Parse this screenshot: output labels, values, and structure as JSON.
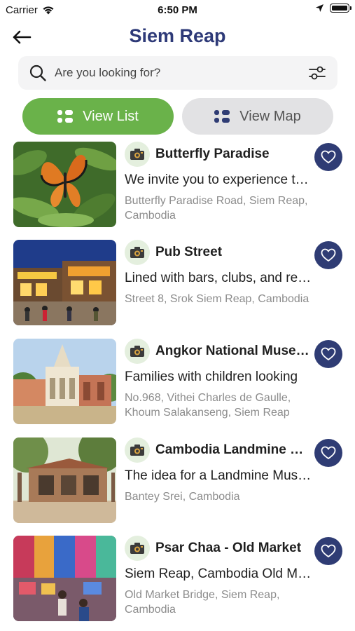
{
  "status_bar": {
    "carrier": "Carrier",
    "time": "6:50 PM"
  },
  "header": {
    "title": "Siem Reap"
  },
  "search": {
    "placeholder": "Are you looking for?"
  },
  "view_toggle": {
    "list_label": "View List",
    "map_label": "View Map",
    "active": "list"
  },
  "colors": {
    "title": "#2e3a78",
    "active_toggle": "#6ab24a",
    "inactive_toggle": "#e2e2e4",
    "favorite": "#2f3c74",
    "badge": "#e4efde",
    "address": "#8c8c8c"
  },
  "places": [
    {
      "name": "Butterfly Paradise",
      "description": "We invite you to experience the beauty",
      "address": "Butterfly Paradise Road, Siem Reap, Cambodia",
      "icon": "camera-icon",
      "favorite_icon": "heart-icon"
    },
    {
      "name": "Pub Street",
      "description": "Lined with bars, clubs, and restaurants",
      "address": "Street 8, Srok Siem Reap, Cambodia",
      "icon": "camera-icon",
      "favorite_icon": "heart-icon"
    },
    {
      "name": "Angkor National Museum",
      "description": "Families with children looking",
      "address": "No.968, Vithei Charles de Gaulle, Khoum Salakanseng, Siem Reap",
      "icon": "camera-icon",
      "favorite_icon": "heart-icon"
    },
    {
      "name": "Cambodia Landmine Museum",
      "description": "The idea for a Landmine Museum",
      "address": "Bantey Srei, Cambodia",
      "icon": "camera-icon",
      "favorite_icon": "heart-icon"
    },
    {
      "name": "Psar Chaa - Old Market",
      "description": "Siem Reap, Cambodia Old Market",
      "address": "Old Market Bridge, Siem Reap, Cambodia",
      "icon": "camera-icon",
      "favorite_icon": "heart-icon"
    }
  ]
}
